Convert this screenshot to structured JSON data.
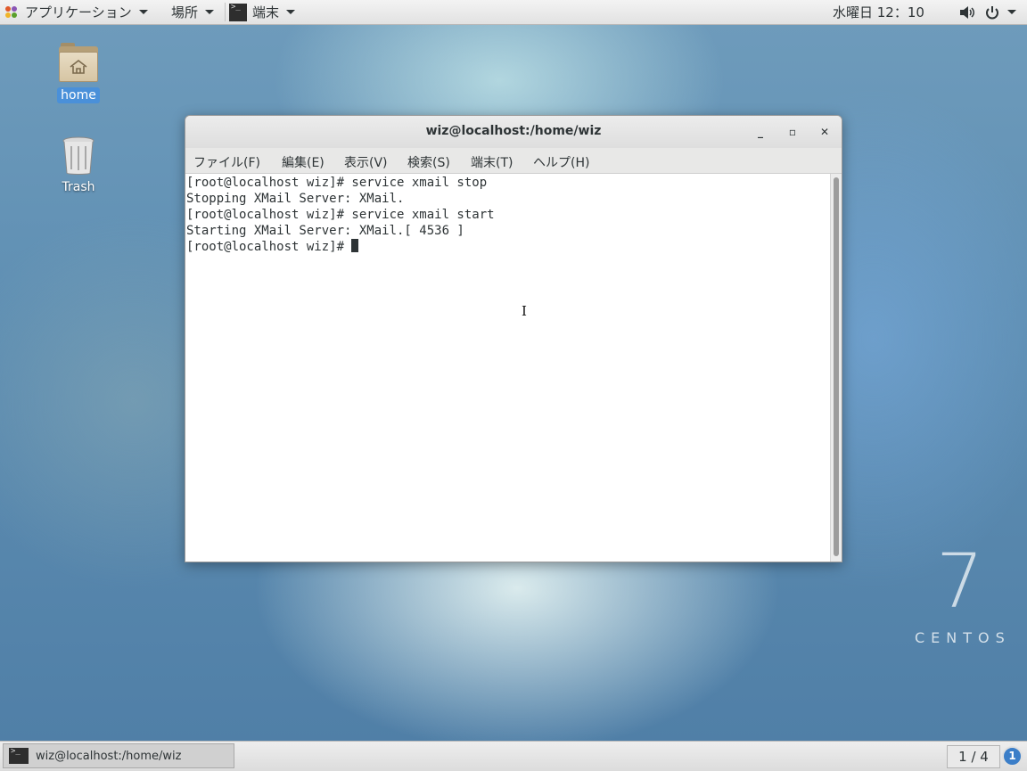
{
  "top_panel": {
    "applications_label": "アプリケーション",
    "places_label": "場所",
    "active_app_label": "端末",
    "clock": "水曜日 12：10"
  },
  "desktop": {
    "home_label": "home",
    "trash_label": "Trash",
    "watermark_number": "7",
    "watermark_word": "CENTOS"
  },
  "terminal": {
    "title": "wiz@localhost:/home/wiz",
    "menu": [
      "ファイル(F)",
      "編集(E)",
      "表示(V)",
      "検索(S)",
      "端末(T)",
      "ヘルプ(H)"
    ],
    "lines": [
      "[root@localhost wiz]# service xmail stop",
      "Stopping XMail Server: XMail.",
      "[root@localhost wiz]# service xmail start",
      "Starting XMail Server: XMail.[ 4536 ]",
      "[root@localhost wiz]# "
    ]
  },
  "bottom_panel": {
    "task_label": "wiz@localhost:/home/wiz",
    "workspace": "1 / 4",
    "notification_count": "1"
  },
  "colors": {
    "selection_blue": "#4a90d9",
    "notification_blue": "#3b7ec8"
  }
}
